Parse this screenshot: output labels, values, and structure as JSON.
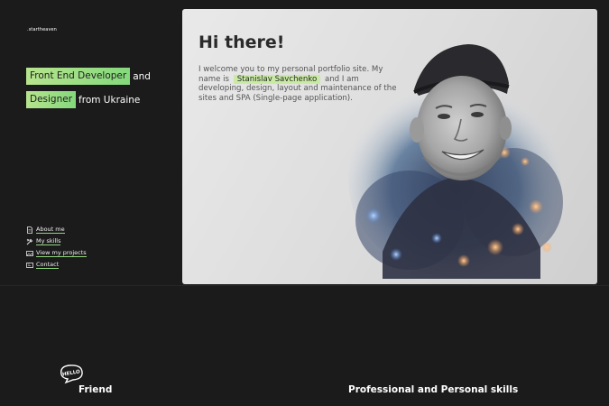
{
  "header": {
    "logo": ".startheaven"
  },
  "tagline": {
    "line1_highlight": "Front End Developer",
    "line1_rest": "and",
    "line2_highlight": "Designer",
    "line2_rest": "from Ukraine"
  },
  "nav": {
    "items": [
      {
        "label": "About me",
        "icon": "document-icon"
      },
      {
        "label": "My skills",
        "icon": "tools-icon"
      },
      {
        "label": "View my projects",
        "icon": "gallery-icon"
      },
      {
        "label": "Contact",
        "icon": "contact-card-icon"
      }
    ]
  },
  "hero": {
    "title": "Hi there!",
    "intro_before": "I welcome you to my personal portfolio site. My name is",
    "name": "Stanislav Savchenko",
    "intro_after": "and I am developing, design, layout and maintenance of the sites and SPA (Single-page application)."
  },
  "sections": {
    "hello_badge": "HELLO",
    "friend_title": "Friend",
    "skills_title": "Professional and Personal skills"
  },
  "colors": {
    "background": "#1b1b1b",
    "accent_green": "#9bdc85",
    "card_bg": "#e2e2e2",
    "title_dark": "#2a2a2a"
  }
}
